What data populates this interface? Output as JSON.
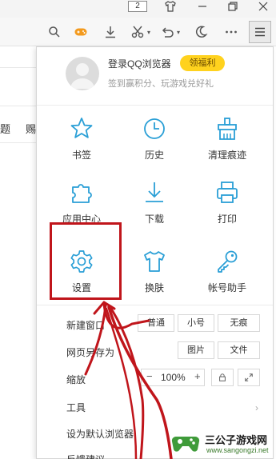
{
  "titlebar": {
    "tab_count": "2"
  },
  "page": {
    "text_left": "题",
    "text_right": "赐"
  },
  "menu": {
    "login_title": "登录QQ浏览器",
    "welfare_badge": "领福利",
    "login_subtitle": "签到赢积分、玩游戏兑好礼",
    "grid": [
      {
        "label": "书签",
        "icon": "star-icon"
      },
      {
        "label": "历史",
        "icon": "clock-icon"
      },
      {
        "label": "清理痕迹",
        "icon": "broom-icon"
      },
      {
        "label": "应用中心",
        "icon": "puzzle-icon"
      },
      {
        "label": "下载",
        "icon": "download-icon"
      },
      {
        "label": "打印",
        "icon": "printer-icon"
      },
      {
        "label": "设置",
        "icon": "gear-icon"
      },
      {
        "label": "换肤",
        "icon": "shirt-icon"
      },
      {
        "label": "帐号助手",
        "icon": "key-icon"
      }
    ],
    "new_window": {
      "label": "新建窗口",
      "options": [
        "普通",
        "小号",
        "无痕"
      ]
    },
    "save_page": {
      "label": "网页另存为",
      "options": [
        "图片",
        "文件"
      ]
    },
    "zoom": {
      "label": "缩放",
      "minus": "−",
      "value": "100%",
      "plus": "+"
    },
    "tools_label": "工具",
    "default_browser_label": "设为默认浏览器",
    "feedback_label": "反馈建议"
  },
  "watermark": {
    "name": "三公子游戏网",
    "url": "www.sangongzi.net"
  },
  "colors": {
    "accent": "#2a9fd6",
    "annotation_red": "#c0151b",
    "welfare_yellow": "#ffd21e"
  }
}
